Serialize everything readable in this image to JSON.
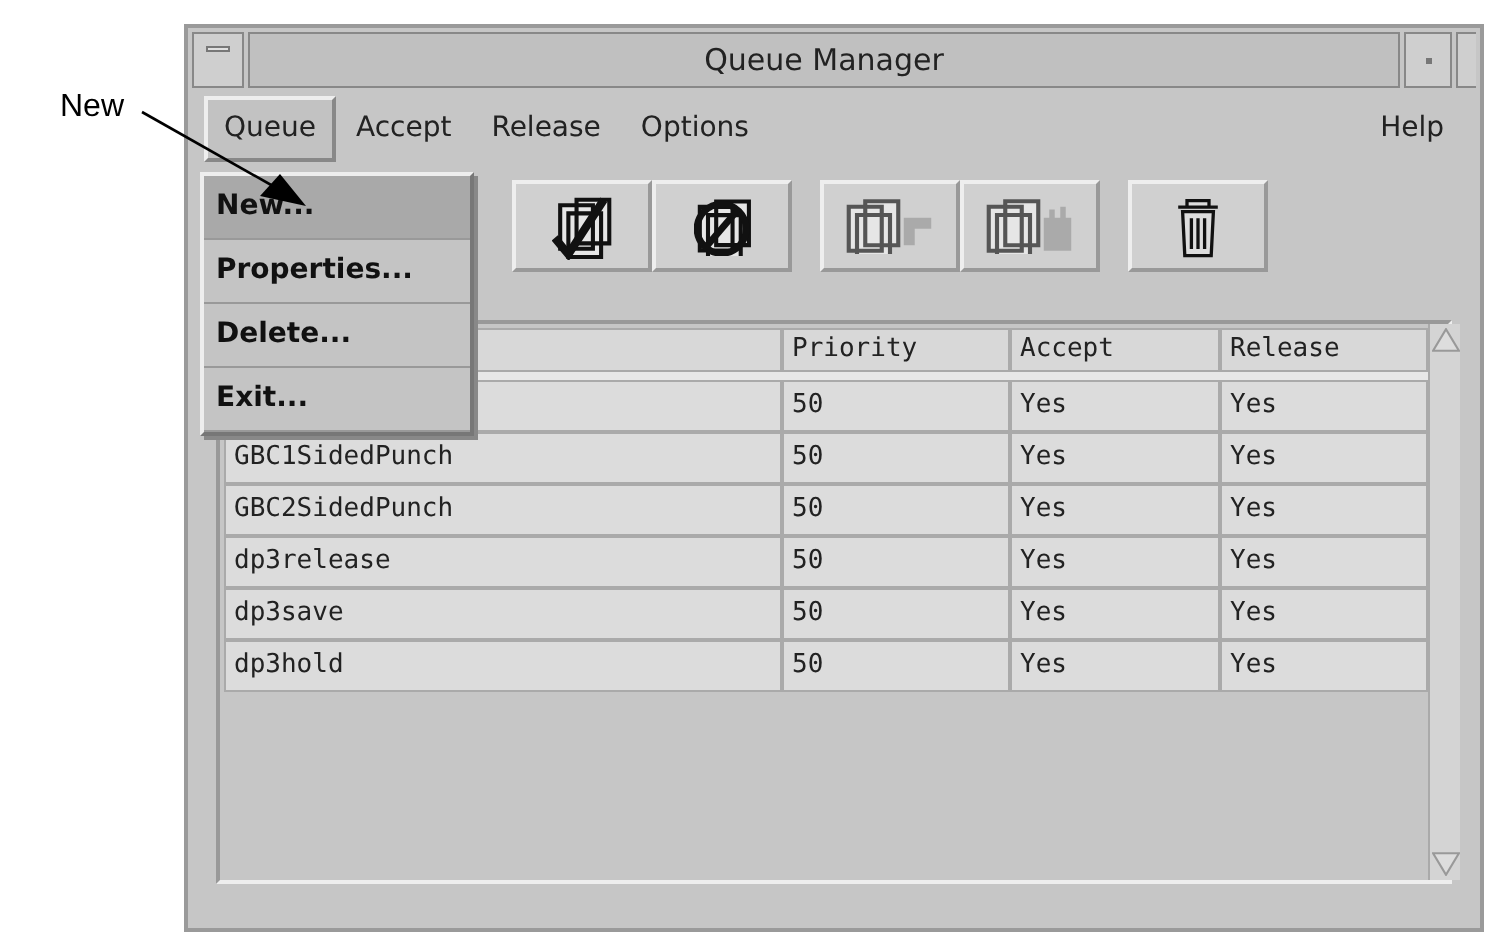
{
  "callout": {
    "label": "New"
  },
  "window": {
    "title": "Queue Manager"
  },
  "menubar": [
    {
      "label": "Queue",
      "selected": true
    },
    {
      "label": "Accept",
      "selected": false
    },
    {
      "label": "Release",
      "selected": false
    },
    {
      "label": "Options",
      "selected": false
    },
    {
      "label": "Help",
      "selected": false
    }
  ],
  "menu": [
    {
      "label": "New...",
      "selected": true
    },
    {
      "label": "Properties...",
      "selected": false
    },
    {
      "label": "Delete...",
      "selected": false
    },
    {
      "label": "Exit...",
      "selected": false
    }
  ],
  "toolbar": [
    {
      "kind": "accept",
      "disabled": false
    },
    {
      "kind": "reject",
      "disabled": false
    },
    {
      "kind": "release",
      "disabled": true
    },
    {
      "kind": "hold",
      "disabled": true
    },
    {
      "kind": "delete",
      "disabled": false
    }
  ],
  "table": {
    "columns": [
      "Priority",
      "Accept",
      "Release"
    ],
    "rows": [
      {
        "cells": [
          "50",
          "Yes",
          "Yes"
        ]
      },
      {
        "name": "GBC1SidedPunch",
        "cells": [
          "50",
          "Yes",
          "Yes"
        ]
      },
      {
        "name": "GBC2SidedPunch",
        "cells": [
          "50",
          "Yes",
          "Yes"
        ]
      },
      {
        "name": "dp3release",
        "cells": [
          "50",
          "Yes",
          "Yes"
        ]
      },
      {
        "name": "dp3save",
        "cells": [
          "50",
          "Yes",
          "Yes"
        ]
      },
      {
        "name": "dp3hold",
        "cells": [
          "50",
          "Yes",
          "Yes"
        ]
      }
    ]
  }
}
